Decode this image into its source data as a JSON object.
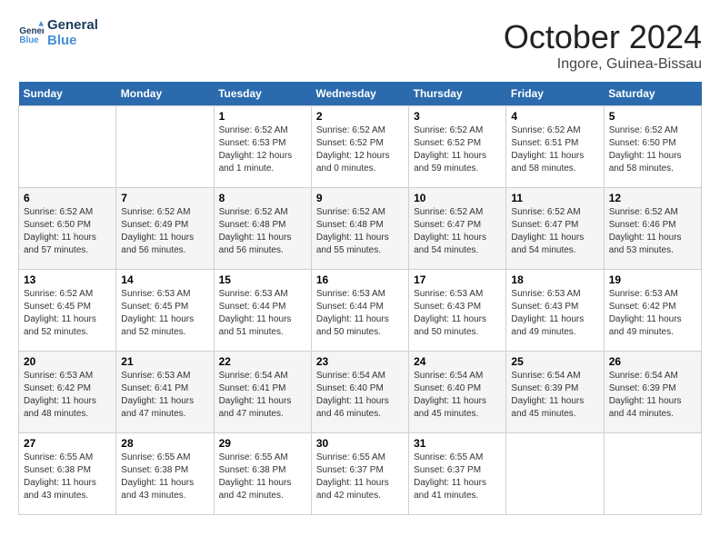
{
  "logo": {
    "text1": "General",
    "text2": "Blue"
  },
  "title": "October 2024",
  "subtitle": "Ingore, Guinea-Bissau",
  "days_of_week": [
    "Sunday",
    "Monday",
    "Tuesday",
    "Wednesday",
    "Thursday",
    "Friday",
    "Saturday"
  ],
  "weeks": [
    [
      {
        "day": "",
        "info": ""
      },
      {
        "day": "",
        "info": ""
      },
      {
        "day": "1",
        "info": "Sunrise: 6:52 AM\nSunset: 6:53 PM\nDaylight: 12 hours\nand 1 minute."
      },
      {
        "day": "2",
        "info": "Sunrise: 6:52 AM\nSunset: 6:52 PM\nDaylight: 12 hours\nand 0 minutes."
      },
      {
        "day": "3",
        "info": "Sunrise: 6:52 AM\nSunset: 6:52 PM\nDaylight: 11 hours\nand 59 minutes."
      },
      {
        "day": "4",
        "info": "Sunrise: 6:52 AM\nSunset: 6:51 PM\nDaylight: 11 hours\nand 58 minutes."
      },
      {
        "day": "5",
        "info": "Sunrise: 6:52 AM\nSunset: 6:50 PM\nDaylight: 11 hours\nand 58 minutes."
      }
    ],
    [
      {
        "day": "6",
        "info": "Sunrise: 6:52 AM\nSunset: 6:50 PM\nDaylight: 11 hours\nand 57 minutes."
      },
      {
        "day": "7",
        "info": "Sunrise: 6:52 AM\nSunset: 6:49 PM\nDaylight: 11 hours\nand 56 minutes."
      },
      {
        "day": "8",
        "info": "Sunrise: 6:52 AM\nSunset: 6:48 PM\nDaylight: 11 hours\nand 56 minutes."
      },
      {
        "day": "9",
        "info": "Sunrise: 6:52 AM\nSunset: 6:48 PM\nDaylight: 11 hours\nand 55 minutes."
      },
      {
        "day": "10",
        "info": "Sunrise: 6:52 AM\nSunset: 6:47 PM\nDaylight: 11 hours\nand 54 minutes."
      },
      {
        "day": "11",
        "info": "Sunrise: 6:52 AM\nSunset: 6:47 PM\nDaylight: 11 hours\nand 54 minutes."
      },
      {
        "day": "12",
        "info": "Sunrise: 6:52 AM\nSunset: 6:46 PM\nDaylight: 11 hours\nand 53 minutes."
      }
    ],
    [
      {
        "day": "13",
        "info": "Sunrise: 6:52 AM\nSunset: 6:45 PM\nDaylight: 11 hours\nand 52 minutes."
      },
      {
        "day": "14",
        "info": "Sunrise: 6:53 AM\nSunset: 6:45 PM\nDaylight: 11 hours\nand 52 minutes."
      },
      {
        "day": "15",
        "info": "Sunrise: 6:53 AM\nSunset: 6:44 PM\nDaylight: 11 hours\nand 51 minutes."
      },
      {
        "day": "16",
        "info": "Sunrise: 6:53 AM\nSunset: 6:44 PM\nDaylight: 11 hours\nand 50 minutes."
      },
      {
        "day": "17",
        "info": "Sunrise: 6:53 AM\nSunset: 6:43 PM\nDaylight: 11 hours\nand 50 minutes."
      },
      {
        "day": "18",
        "info": "Sunrise: 6:53 AM\nSunset: 6:43 PM\nDaylight: 11 hours\nand 49 minutes."
      },
      {
        "day": "19",
        "info": "Sunrise: 6:53 AM\nSunset: 6:42 PM\nDaylight: 11 hours\nand 49 minutes."
      }
    ],
    [
      {
        "day": "20",
        "info": "Sunrise: 6:53 AM\nSunset: 6:42 PM\nDaylight: 11 hours\nand 48 minutes."
      },
      {
        "day": "21",
        "info": "Sunrise: 6:53 AM\nSunset: 6:41 PM\nDaylight: 11 hours\nand 47 minutes."
      },
      {
        "day": "22",
        "info": "Sunrise: 6:54 AM\nSunset: 6:41 PM\nDaylight: 11 hours\nand 47 minutes."
      },
      {
        "day": "23",
        "info": "Sunrise: 6:54 AM\nSunset: 6:40 PM\nDaylight: 11 hours\nand 46 minutes."
      },
      {
        "day": "24",
        "info": "Sunrise: 6:54 AM\nSunset: 6:40 PM\nDaylight: 11 hours\nand 45 minutes."
      },
      {
        "day": "25",
        "info": "Sunrise: 6:54 AM\nSunset: 6:39 PM\nDaylight: 11 hours\nand 45 minutes."
      },
      {
        "day": "26",
        "info": "Sunrise: 6:54 AM\nSunset: 6:39 PM\nDaylight: 11 hours\nand 44 minutes."
      }
    ],
    [
      {
        "day": "27",
        "info": "Sunrise: 6:55 AM\nSunset: 6:38 PM\nDaylight: 11 hours\nand 43 minutes."
      },
      {
        "day": "28",
        "info": "Sunrise: 6:55 AM\nSunset: 6:38 PM\nDaylight: 11 hours\nand 43 minutes."
      },
      {
        "day": "29",
        "info": "Sunrise: 6:55 AM\nSunset: 6:38 PM\nDaylight: 11 hours\nand 42 minutes."
      },
      {
        "day": "30",
        "info": "Sunrise: 6:55 AM\nSunset: 6:37 PM\nDaylight: 11 hours\nand 42 minutes."
      },
      {
        "day": "31",
        "info": "Sunrise: 6:55 AM\nSunset: 6:37 PM\nDaylight: 11 hours\nand 41 minutes."
      },
      {
        "day": "",
        "info": ""
      },
      {
        "day": "",
        "info": ""
      }
    ]
  ]
}
